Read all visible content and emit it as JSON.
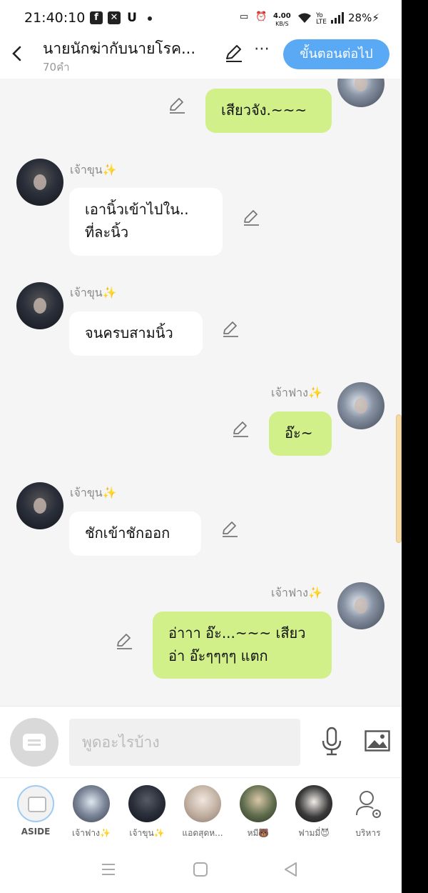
{
  "status_bar": {
    "time": "21:40:10",
    "speed_value": "4.00",
    "speed_unit": "KB/S",
    "volte": "Yo LTE",
    "battery": "28%"
  },
  "header": {
    "title": "นายนักฆ่ากับนายโรค...",
    "subtitle": "70คำ",
    "next_button": "ขั้นตอนต่อไป"
  },
  "messages": [
    {
      "side": "right",
      "text": "เสียวจัง.~~~"
    },
    {
      "side": "left",
      "name": "เจ้าขุน",
      "text": "เอานิ้วเข้าไปใน..\nที่ละนิ้ว"
    },
    {
      "side": "left",
      "name": "เจ้าขุน",
      "text": "จนครบสามนิ้ว"
    },
    {
      "side": "right",
      "name": "เจ้าฟาง",
      "text": "อ๊ะ~"
    },
    {
      "side": "left",
      "name": "เจ้าขุน",
      "text": "ชักเข้าชักออก"
    },
    {
      "side": "right",
      "name": "เจ้าฟาง",
      "text": "อ่าาา อ๊ะ...~~~ เสียว\nอ่า อ๊ะๆๆๆๆ แตก"
    }
  ],
  "input": {
    "placeholder": "พูดอะไรบ้าง"
  },
  "characters": [
    {
      "label": "ASIDE"
    },
    {
      "label": "เจ้าฟาง✨"
    },
    {
      "label": "เจ้าขุน✨"
    },
    {
      "label": "แอดสุดห..."
    },
    {
      "label": "หมี🐻"
    },
    {
      "label": "ฟามมี่😈"
    },
    {
      "label": "บริหาร"
    }
  ],
  "sparkle": "✨",
  "colors": {
    "accent": "#5aa9f5",
    "right_bubble": "#d2f08a",
    "left_bubble": "#ffffff",
    "background": "#f5f5f5"
  }
}
